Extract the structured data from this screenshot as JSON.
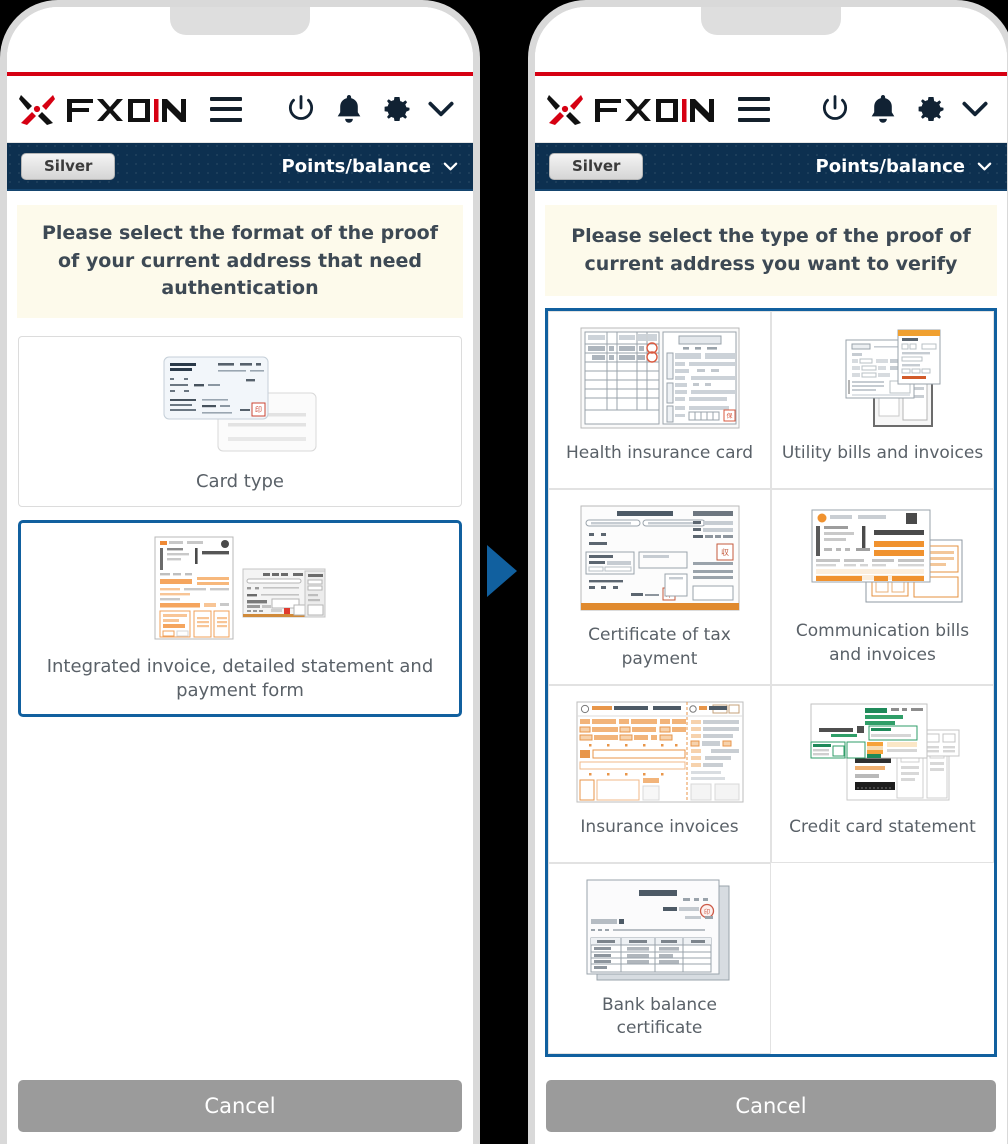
{
  "brand": {
    "name": "FXON",
    "accent_red": "#d60012",
    "navy": "#0d3050",
    "select_blue": "#11609f",
    "notice_bg": "#fdfaeb"
  },
  "header": {
    "logo_text": "FXON",
    "menu_icon": "hamburger-menu-icon",
    "icons": [
      {
        "name": "power-icon"
      },
      {
        "name": "bell-icon"
      },
      {
        "name": "gear-icon"
      },
      {
        "name": "chevron-down-icon"
      }
    ]
  },
  "points_bar": {
    "rank_badge": "Silver",
    "points_label": "Points/balance",
    "chevron": "chevron-down-icon"
  },
  "screen_left": {
    "notice": "Please select the format of the proof of your current address that need authentication",
    "options": [
      {
        "label": "Card type",
        "thumb": "card-type-thumb",
        "selected": false
      },
      {
        "label": "Integrated invoice, detailed statement and payment form",
        "thumb": "invoice-thumb",
        "selected": true
      }
    ],
    "cancel_label": "Cancel"
  },
  "screen_right": {
    "notice": "Please select the type of the proof of current address you want to verify",
    "items": [
      {
        "label": "Health insurance card",
        "thumb": "health-insurance-thumb"
      },
      {
        "label": "Utility bills and invoices",
        "thumb": "utility-bills-thumb"
      },
      {
        "label": "Certificate of tax payment",
        "thumb": "tax-certificate-thumb"
      },
      {
        "label": "Communication bills and invoices",
        "thumb": "communication-bills-thumb"
      },
      {
        "label": "Insurance invoices",
        "thumb": "insurance-invoices-thumb"
      },
      {
        "label": "Credit card statement",
        "thumb": "credit-card-statement-thumb"
      },
      {
        "label": "Bank balance certificate",
        "thumb": "bank-balance-thumb"
      }
    ],
    "cancel_label": "Cancel"
  },
  "arrow": {
    "name": "transition-arrow",
    "direction": "right"
  }
}
